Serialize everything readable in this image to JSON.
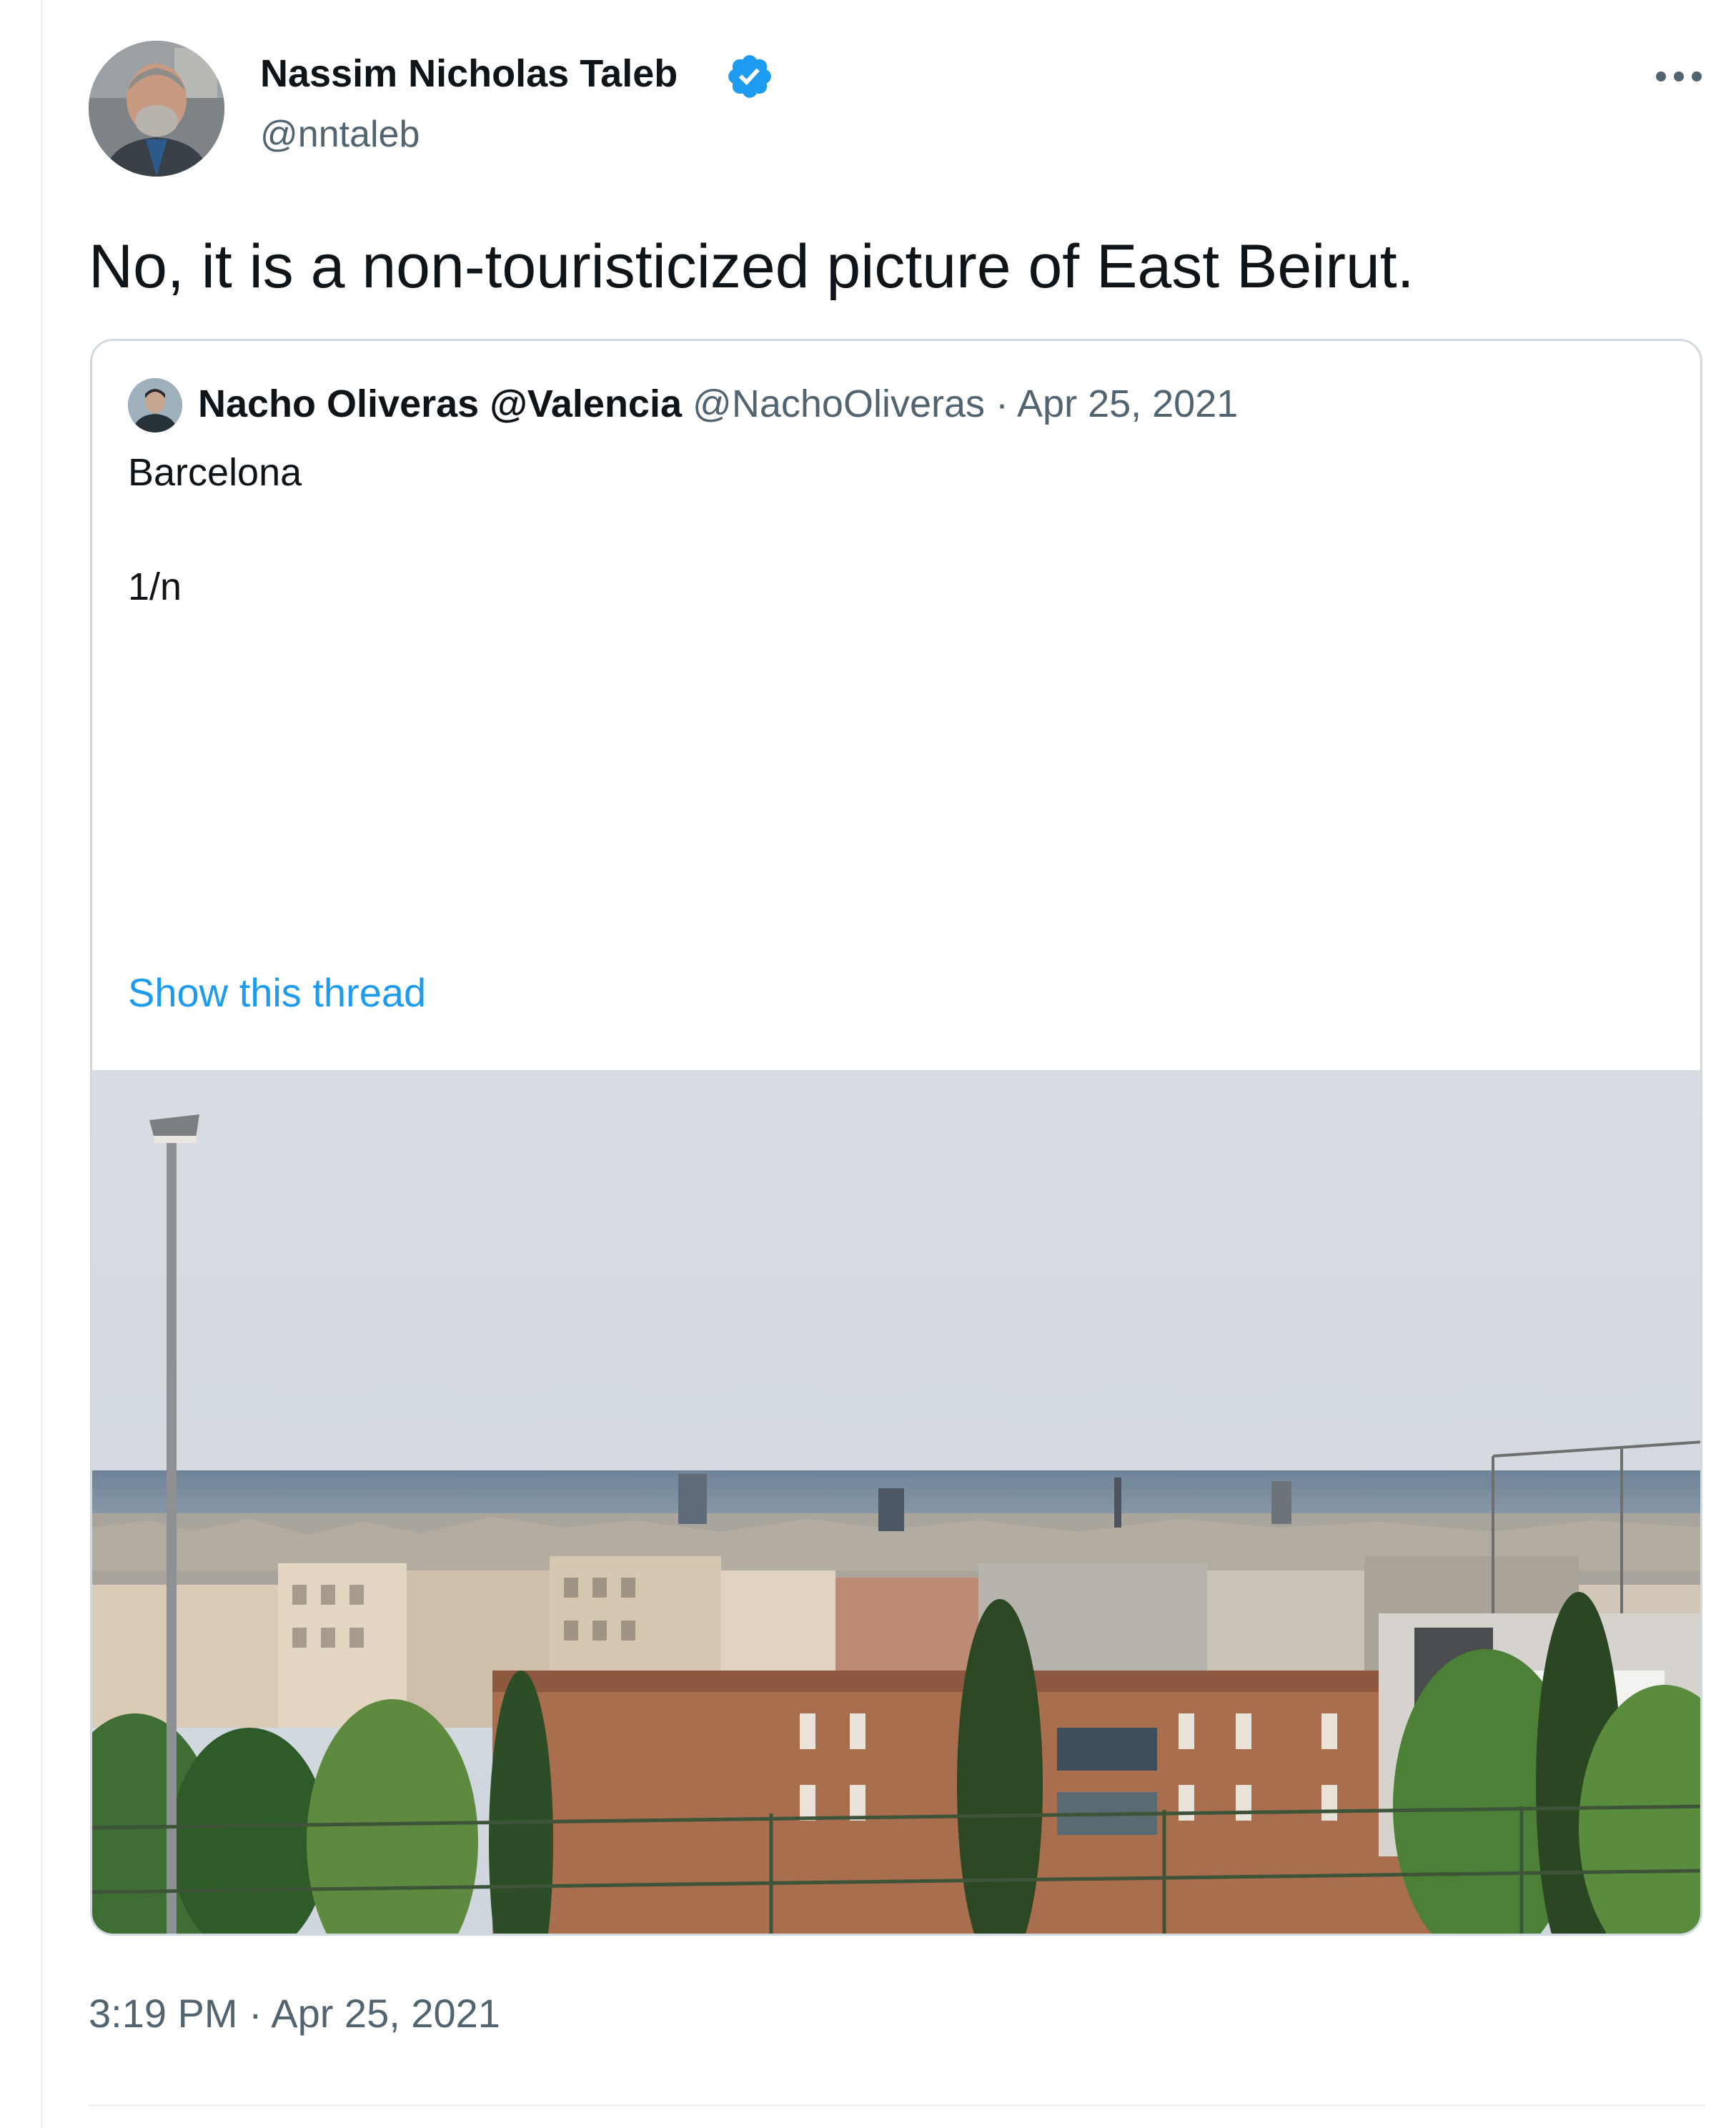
{
  "author": {
    "name": "Nassim Nicholas Taleb",
    "handle": "@nntaleb",
    "verified": true
  },
  "tweet": {
    "text": "No, it is a non-touristicized picture of East Beirut.",
    "timestamp": "3:19 PM · Apr 25, 2021"
  },
  "quoted_tweet": {
    "name": "Nacho Oliveras @Valencia",
    "handle": "@NachoOliveras",
    "separator": "·",
    "date": "Apr 25, 2021",
    "text_line1": "Barcelona",
    "text_line2": "1/n",
    "show_thread": "Show this thread"
  },
  "colors": {
    "accent": "#1d9bf0",
    "text_primary": "#0f1419",
    "text_secondary": "#536471",
    "border": "#cfd9de"
  },
  "icons": {
    "verified": "verified-badge-icon",
    "more": "more-options-icon"
  }
}
